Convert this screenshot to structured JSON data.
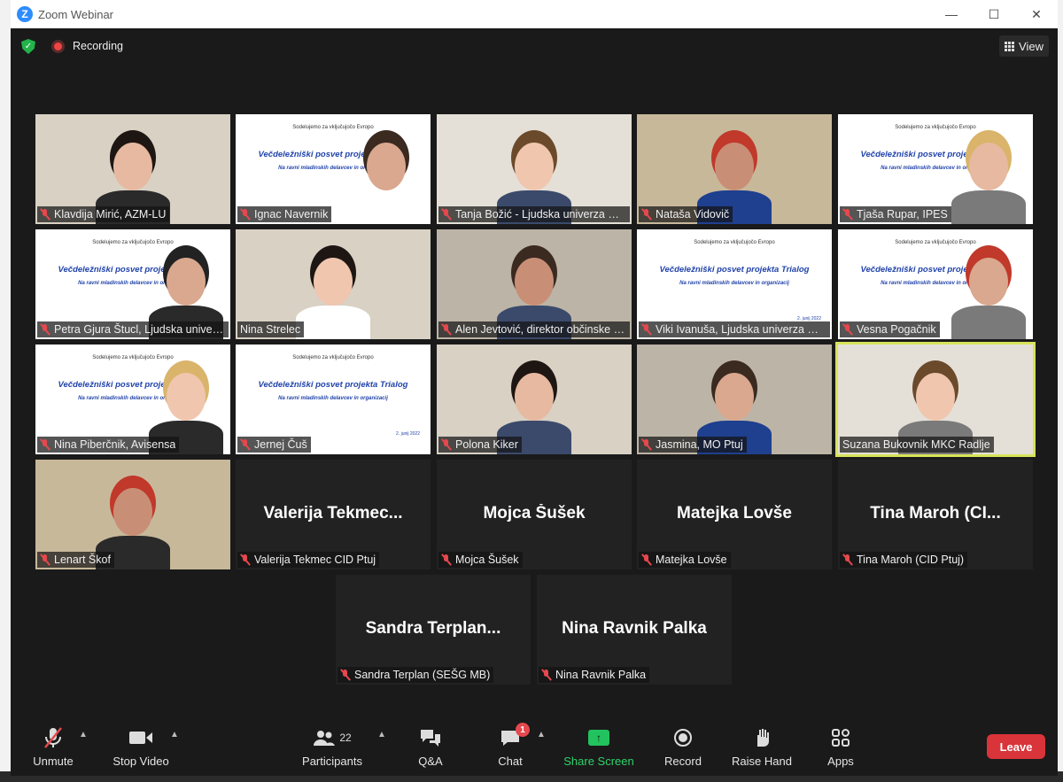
{
  "window": {
    "title": "Zoom Webinar"
  },
  "topbar": {
    "recording_label": "Recording",
    "view_label": "View"
  },
  "slide": {
    "header": "Sodelujemo za vključujočo Evropo",
    "title": "Večdeležniški posvet projekta Trialog",
    "subtitle": "Na ravni mladinskih delavcev in organizacij",
    "date": "2. junij 2022"
  },
  "participants": [
    {
      "name": "Klavdija Mirić, AZM-LU",
      "kind": "video",
      "muted": true
    },
    {
      "name": "Ignac Navernik",
      "kind": "slide-person",
      "muted": true
    },
    {
      "name": "Tanja Božić - Ljudska univerza Ptuj",
      "kind": "video",
      "muted": true
    },
    {
      "name": "Nataša Vidovič",
      "kind": "video",
      "muted": true
    },
    {
      "name": "Tjaša Rupar, IPES",
      "kind": "slide-person",
      "muted": true
    },
    {
      "name": "Petra Gjura Štucl, Ljudska univerza",
      "kind": "slide-person",
      "muted": true
    },
    {
      "name": "Nina Strelec",
      "kind": "video",
      "muted": false
    },
    {
      "name": "Alen Jevtović, direktor občinske uprave",
      "kind": "video",
      "muted": true
    },
    {
      "name": "Viki Ivanuša, Ljudska univerza Ormož",
      "kind": "slide",
      "muted": true
    },
    {
      "name": "Vesna Pogačnik",
      "kind": "slide-person",
      "muted": true
    },
    {
      "name": "Nina Piberčnik, Avisensa",
      "kind": "slide-person",
      "muted": true
    },
    {
      "name": "Jernej Čuš",
      "kind": "slide",
      "muted": true
    },
    {
      "name": "Polona Kiker",
      "kind": "video",
      "muted": true
    },
    {
      "name": "Jasmina, MO Ptuj",
      "kind": "video",
      "muted": true
    },
    {
      "name": "Suzana Bukovnik MKC Radlje",
      "kind": "video",
      "muted": false,
      "active": true
    },
    {
      "name": "Lenart Škof",
      "kind": "video",
      "muted": true
    },
    {
      "name": "Valerija Tekmec CID Ptuj",
      "big": "Valerija Tekmec...",
      "kind": "dark",
      "muted": true
    },
    {
      "name": "Mojca Šušek",
      "big": "Mojca Šušek",
      "kind": "dark",
      "muted": true
    },
    {
      "name": "Matejka Lovše",
      "big": "Matejka Lovše",
      "kind": "dark",
      "muted": true
    },
    {
      "name": "Tina Maroh (CID Ptuj)",
      "big": "Tina Maroh (CI...",
      "kind": "dark",
      "muted": true
    },
    {
      "name": "Sandra Terplan (SEŠG MB)",
      "big": "Sandra Terplan...",
      "kind": "dark",
      "muted": true
    },
    {
      "name": "Nina Ravnik Palka",
      "big": "Nina Ravnik Palka",
      "kind": "dark",
      "muted": true
    }
  ],
  "toolbar": {
    "unmute": "Unmute",
    "stop_video": "Stop Video",
    "participants": "Participants",
    "participants_count": "22",
    "qa": "Q&A",
    "chat": "Chat",
    "chat_badge": "1",
    "share_screen": "Share Screen",
    "record": "Record",
    "raise_hand": "Raise Hand",
    "apps": "Apps",
    "leave": "Leave"
  },
  "colors": {
    "accent": "#2d8cff",
    "leave": "#d9343a",
    "share": "#22c35e",
    "active_speaker": "#d7e35a",
    "muted": "#e5484d"
  }
}
